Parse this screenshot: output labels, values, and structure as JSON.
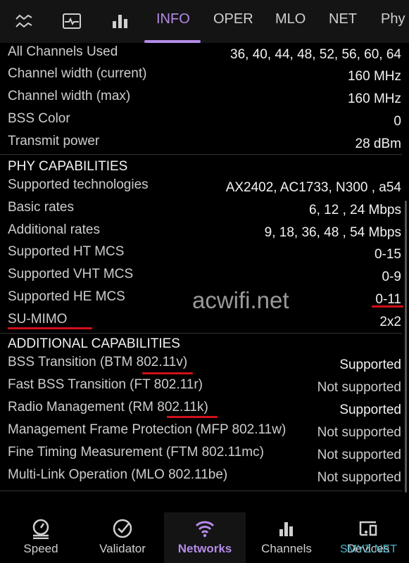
{
  "tabs": {
    "items": [
      "INFO",
      "OPER",
      "MLO",
      "NET",
      "Phy"
    ],
    "active": "INFO",
    "icons": [
      "signal-waves-icon",
      "monitor-pulse-icon",
      "bar-chart-icon"
    ]
  },
  "rows_top": [
    {
      "label": "All Channels Used",
      "value": "36, 40, 44, 48, 52, 56, 60, 64"
    },
    {
      "label": "Channel width (current)",
      "value": "160 MHz"
    },
    {
      "label": "Channel width (max)",
      "value": "160 MHz"
    },
    {
      "label": "BSS Color",
      "value": "0"
    },
    {
      "label": "Transmit power",
      "value": "28 dBm"
    }
  ],
  "phy": {
    "heading": "PHY CAPABILITIES",
    "rows": [
      {
        "label": "Supported technologies",
        "value": "AX2402, AC1733, N300 , a54"
      },
      {
        "label": "Basic rates",
        "value": "6, 12 , 24 Mbps"
      },
      {
        "label": "Additional rates",
        "value": "9, 18, 36, 48 , 54 Mbps"
      },
      {
        "label": "Supported HT MCS",
        "value": "0-15"
      },
      {
        "label": "Supported VHT MCS",
        "value": "0-9"
      },
      {
        "label": "Supported HE MCS",
        "value": "0-11"
      },
      {
        "label": "SU-MIMO",
        "value": "2x2"
      }
    ]
  },
  "additional": {
    "heading": "ADDITIONAL CAPABILITIES",
    "rows": [
      {
        "label": "BSS Transition (BTM 802.11v)",
        "value": "Supported"
      },
      {
        "label": "Fast BSS Transition (FT 802.11r)",
        "value": "Not supported"
      },
      {
        "label": "Radio Management (RM 802.11k)",
        "value": "Supported"
      },
      {
        "label": "Management Frame Protection (MFP 802.11w)",
        "value": "Not supported"
      },
      {
        "label": "Fine Timing Measurement (FTM 802.11mc)",
        "value": "Not supported"
      },
      {
        "label": "Multi-Link Operation (MLO 802.11be)",
        "value": "Not supported"
      }
    ]
  },
  "watermark": "acwifi.net",
  "watermark2": "SMYZ.NET",
  "bottom_nav": {
    "items": [
      {
        "label": "Speed",
        "icon": "speedometer-icon"
      },
      {
        "label": "Validator",
        "icon": "check-circle-icon"
      },
      {
        "label": "Networks",
        "icon": "wifi-icon"
      },
      {
        "label": "Channels",
        "icon": "bar-chart-icon"
      },
      {
        "label": "Devices",
        "icon": "devices-icon"
      }
    ],
    "active": "Networks"
  },
  "colors": {
    "accent": "#b48be8",
    "highlight": "#d0101a"
  }
}
